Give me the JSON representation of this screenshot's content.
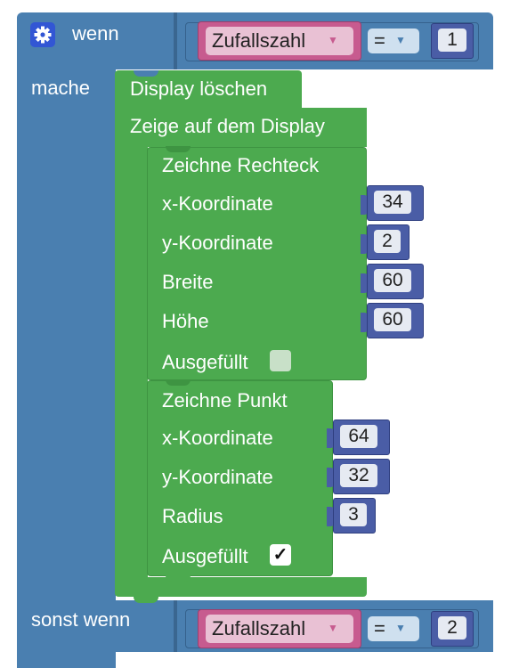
{
  "if_block": {
    "keyword": "wenn",
    "do_keyword": "mache",
    "condition": {
      "variable": "Zufallszahl",
      "operator": "=",
      "value": "1"
    }
  },
  "actions": {
    "clear_display": "Display löschen",
    "show_on_display": "Zeige auf dem Display"
  },
  "rectangle": {
    "title": "Zeichne Rechteck",
    "x_label": "x-Koordinate",
    "x_value": "34",
    "y_label": "y-Koordinate",
    "y_value": "2",
    "width_label": "Breite",
    "width_value": "60",
    "height_label": "Höhe",
    "height_value": "60",
    "filled_label": "Ausgefüllt",
    "filled": false
  },
  "point": {
    "title": "Zeichne Punkt",
    "x_label": "x-Koordinate",
    "x_value": "64",
    "y_label": "y-Koordinate",
    "y_value": "32",
    "radius_label": "Radius",
    "radius_value": "3",
    "filled_label": "Ausgefüllt",
    "filled": true,
    "check_glyph": "✓"
  },
  "else_if_block": {
    "keyword": "sonst wenn",
    "condition": {
      "variable": "Zufallszahl",
      "operator": "=",
      "value": "2"
    }
  },
  "icons": {
    "gear": "gear-icon",
    "dropdown": "▼"
  },
  "colors": {
    "control": "#4a7fb0",
    "display": "#4caa4f",
    "variable": "#c75b8f",
    "math": "#4a5da6",
    "compare": "#4a7fb0"
  }
}
